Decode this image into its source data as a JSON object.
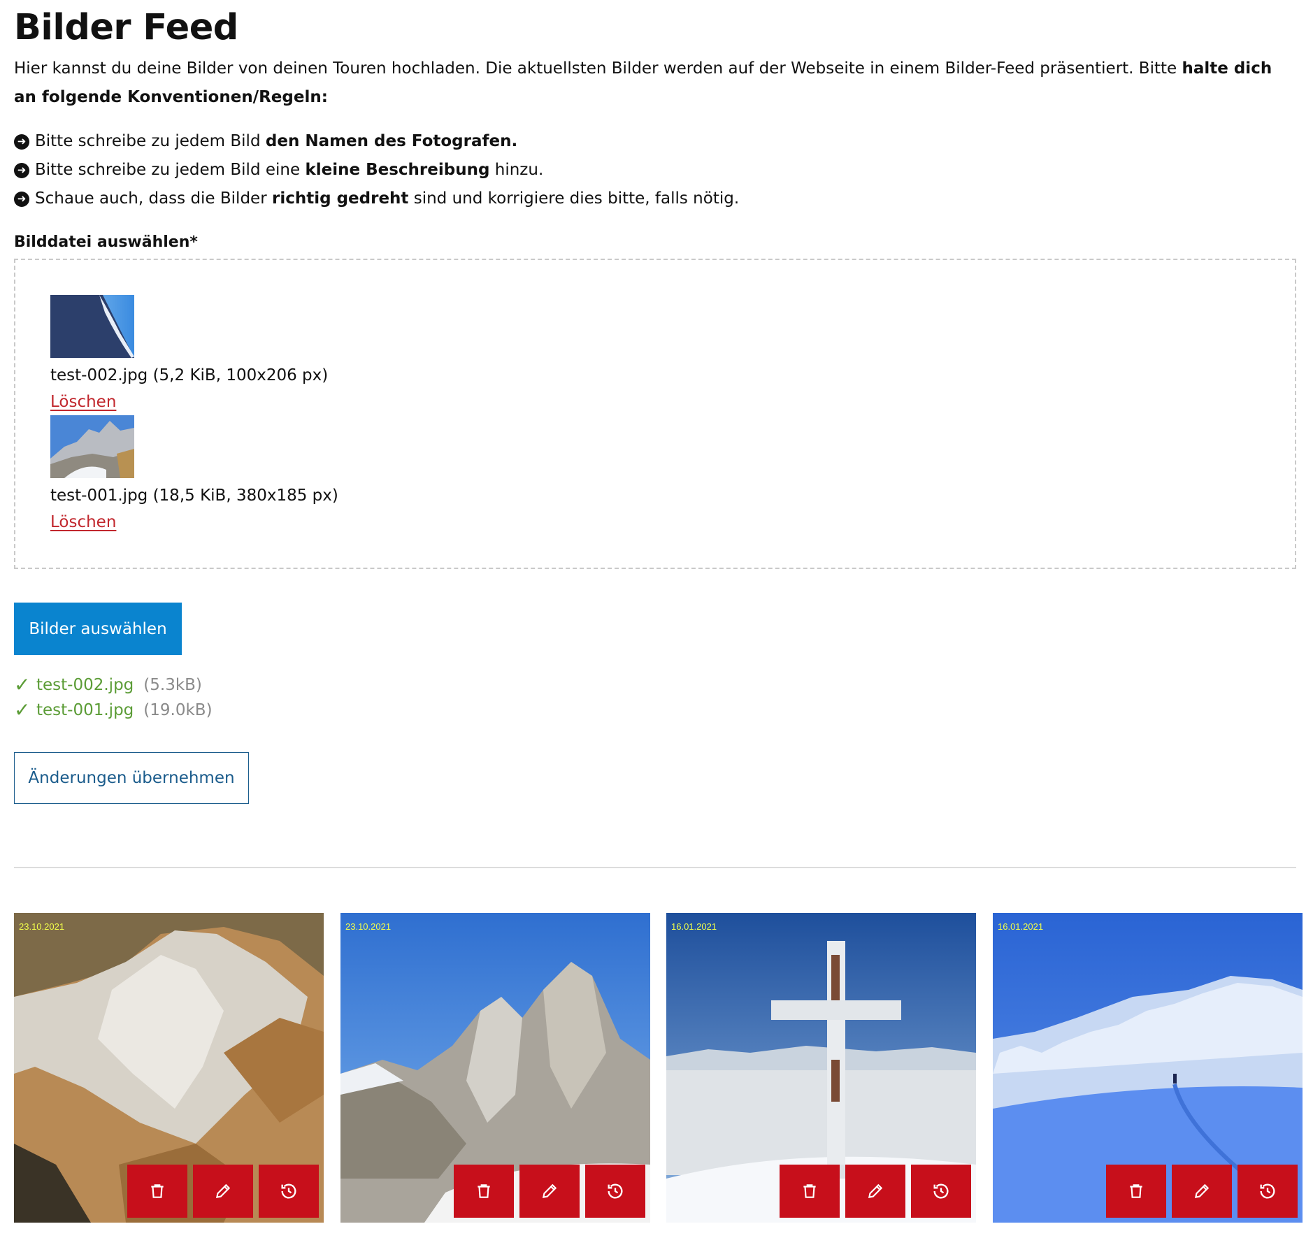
{
  "page": {
    "title": "Bilder Feed",
    "intro_text": "Hier kannst du deine Bilder von deinen Touren hochladen. Die aktuellsten Bilder werden auf der Webseite in einem Bilder-Feed präsentiert. Bitte ",
    "intro_bold": "halte dich an folgende Konventionen/Regeln:"
  },
  "rules": [
    {
      "pre": "Bitte schreibe zu jedem Bild ",
      "bold": "den Namen des Fotografen.",
      "post": ""
    },
    {
      "pre": "Bitte schreibe zu jedem Bild eine ",
      "bold": "kleine Beschreibung",
      "post": " hinzu."
    },
    {
      "pre": "Schaue auch, dass die Bilder ",
      "bold": "richtig gedreht",
      "post": " sind und korrigiere dies bitte, falls nötig."
    }
  ],
  "upload_field": {
    "label": "Bilddatei auswählen*",
    "files": [
      {
        "info": "test-002.jpg (5,2 KiB, 100x206 px)",
        "delete_label": "Löschen"
      },
      {
        "info": "test-001.jpg (18,5 KiB, 380x185 px)",
        "delete_label": "Löschen"
      }
    ]
  },
  "select_button": "Bilder auswählen",
  "uploaded": [
    {
      "name": "test-002.jpg",
      "size": "(5.3kB)"
    },
    {
      "name": "test-001.jpg",
      "size": "(19.0kB)"
    }
  ],
  "apply_button": "Änderungen übernehmen",
  "feed": [
    {
      "date": "23.10.2021",
      "icons": [
        "trash-icon",
        "pencil-icon",
        "history-icon"
      ]
    },
    {
      "date": "23.10.2021",
      "icons": [
        "trash-icon",
        "pencil-icon",
        "history-icon"
      ]
    },
    {
      "date": "16.01.2021",
      "icons": [
        "trash-icon",
        "pencil-icon",
        "history-icon"
      ]
    },
    {
      "date": "16.01.2021",
      "icons": [
        "trash-icon",
        "pencil-icon",
        "history-icon"
      ]
    }
  ],
  "colors": {
    "primary_button": "#0a84cf",
    "action_red": "#c70f1b",
    "delete_link": "#c1272d",
    "success_green": "#5b9c36",
    "date_yellow": "#f2ff4a"
  }
}
